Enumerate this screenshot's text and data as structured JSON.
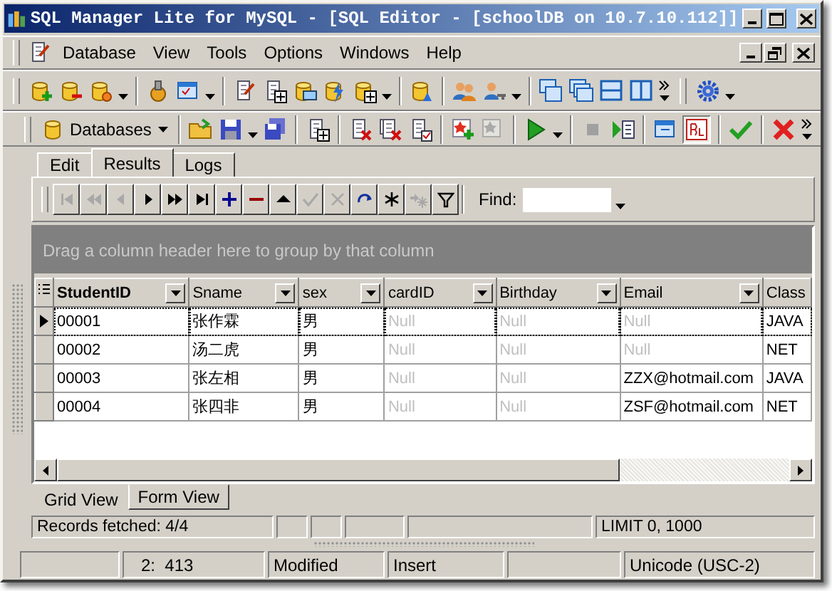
{
  "window": {
    "title": "SQL Manager Lite for MySQL - [SQL Editor - [schoolDB on 10.7.10.112]]"
  },
  "menu": [
    {
      "label": "Database"
    },
    {
      "label": "View"
    },
    {
      "label": "Tools"
    },
    {
      "label": "Options"
    },
    {
      "label": "Windows"
    },
    {
      "label": "Help"
    }
  ],
  "toolbar": {
    "databases_label": "Databases"
  },
  "editor_tabs": [
    {
      "label": "Edit",
      "selected": false
    },
    {
      "label": "Results",
      "selected": true
    },
    {
      "label": "Logs",
      "selected": false
    }
  ],
  "navigator": {
    "buttons": [
      {
        "kind": "first",
        "disabled": true
      },
      {
        "kind": "prior-page",
        "disabled": true
      },
      {
        "kind": "prior",
        "disabled": true
      },
      {
        "kind": "next",
        "disabled": false
      },
      {
        "kind": "next-page",
        "disabled": false
      },
      {
        "kind": "last",
        "disabled": false
      },
      {
        "kind": "insert",
        "disabled": false
      },
      {
        "kind": "delete",
        "disabled": false
      },
      {
        "kind": "edit",
        "disabled": false
      },
      {
        "kind": "post",
        "disabled": true
      },
      {
        "kind": "cancel",
        "disabled": true
      },
      {
        "kind": "refresh",
        "disabled": false
      },
      {
        "kind": "bookmark",
        "disabled": false
      },
      {
        "kind": "goto-bookmark",
        "disabled": true
      },
      {
        "kind": "filter",
        "disabled": false
      }
    ],
    "find_label": "Find:"
  },
  "grid": {
    "group_hint": "Drag a column header here to group by that column",
    "columns": [
      {
        "label": "StudentID",
        "focused": true
      },
      {
        "label": "Sname",
        "focused": false
      },
      {
        "label": "sex",
        "focused": false
      },
      {
        "label": "cardID",
        "focused": false
      },
      {
        "label": "Birthday",
        "focused": false
      },
      {
        "label": "Email",
        "focused": false
      },
      {
        "label": "Class",
        "focused": false
      }
    ],
    "rows": [
      {
        "current": true,
        "cells": [
          {
            "text": "00001",
            "null": false
          },
          {
            "text": "张作霖",
            "null": false
          },
          {
            "text": "男",
            "null": false
          },
          {
            "text": "Null",
            "null": true
          },
          {
            "text": "Null",
            "null": true
          },
          {
            "text": "Null",
            "null": true
          },
          {
            "text": "JAVA",
            "null": false
          }
        ]
      },
      {
        "current": false,
        "cells": [
          {
            "text": "00002",
            "null": false
          },
          {
            "text": "汤二虎",
            "null": false
          },
          {
            "text": "男",
            "null": false
          },
          {
            "text": "Null",
            "null": true
          },
          {
            "text": "Null",
            "null": true
          },
          {
            "text": "Null",
            "null": true
          },
          {
            "text": "NET",
            "null": false
          }
        ]
      },
      {
        "current": false,
        "cells": [
          {
            "text": "00003",
            "null": false
          },
          {
            "text": "张左相",
            "null": false
          },
          {
            "text": "男",
            "null": false
          },
          {
            "text": "Null",
            "null": true
          },
          {
            "text": "Null",
            "null": true
          },
          {
            "text": "ZZX@hotmail.com",
            "null": false
          },
          {
            "text": "JAVA",
            "null": false
          }
        ]
      },
      {
        "current": false,
        "cells": [
          {
            "text": "00004",
            "null": false
          },
          {
            "text": "张四非",
            "null": false
          },
          {
            "text": "男",
            "null": false
          },
          {
            "text": "Null",
            "null": true
          },
          {
            "text": "Null",
            "null": true
          },
          {
            "text": "ZSF@hotmail.com",
            "null": false
          },
          {
            "text": "NET",
            "null": false
          }
        ]
      }
    ]
  },
  "view_tabs": [
    {
      "label": "Grid View",
      "selected": true
    },
    {
      "label": "Form View",
      "selected": false
    }
  ],
  "records_status": {
    "fetched": "Records fetched: 4/4",
    "limit": "LIMIT 0, 1000"
  },
  "status_bar": {
    "position": "2:  413",
    "state": "Modified",
    "mode": "Insert",
    "encoding": "Unicode (USC-2)"
  }
}
